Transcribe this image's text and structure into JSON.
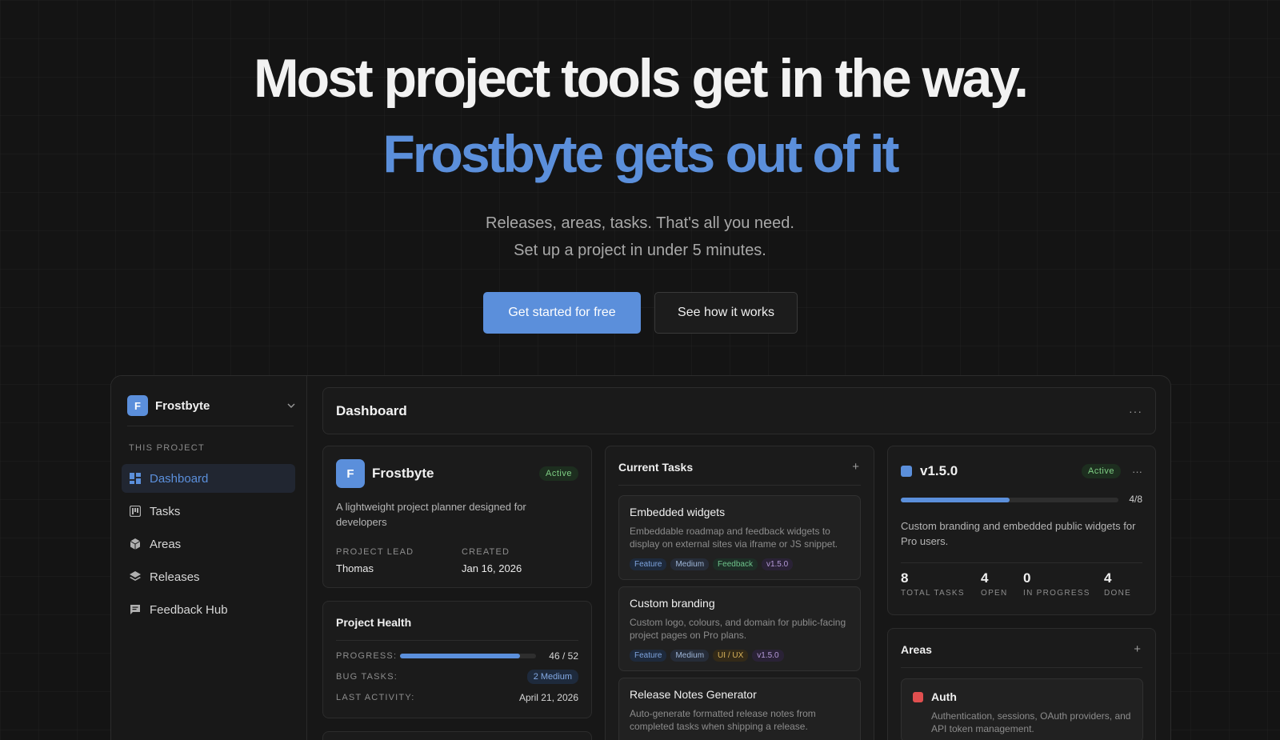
{
  "hero": {
    "headline": "Most project tools get in the way.",
    "headline_accent": "Frostbyte gets out of it",
    "subtitle_line1": "Releases, areas, tasks. That's all you need.",
    "subtitle_line2": "Set up a project in under 5 minutes.",
    "cta_primary": "Get started for free",
    "cta_secondary": "See how it works"
  },
  "colors": {
    "background": "#141414",
    "accent": "#5b8fdb",
    "active_badge": "#7fcf84",
    "area_auth": "#e04f4f"
  },
  "sidebar": {
    "project_initial": "F",
    "project_name": "Frostbyte",
    "section_label": "THIS PROJECT",
    "items": [
      {
        "label": "Dashboard",
        "icon": "dashboard-icon",
        "active": true
      },
      {
        "label": "Tasks",
        "icon": "tasks-icon",
        "active": false
      },
      {
        "label": "Areas",
        "icon": "cube-icon",
        "active": false
      },
      {
        "label": "Releases",
        "icon": "layers-icon",
        "active": false
      },
      {
        "label": "Feedback Hub",
        "icon": "chat-icon",
        "active": false
      }
    ]
  },
  "main": {
    "title": "Dashboard",
    "menu_icon": "more-icon"
  },
  "project_card": {
    "initial": "F",
    "name": "Frostbyte",
    "status": "Active",
    "description": "A lightweight project planner designed for developers",
    "lead_label": "PROJECT LEAD",
    "lead_value": "Thomas",
    "created_label": "CREATED",
    "created_value": "Jan 16, 2026"
  },
  "health": {
    "title": "Project Health",
    "progress_label": "PROGRESS:",
    "progress_value": "46 / 52",
    "progress_fraction": 0.885,
    "bugs_label": "BUG TASKS:",
    "bugs_value": "2 Medium",
    "activity_label": "LAST ACTIVITY:",
    "activity_value": "April 21, 2026"
  },
  "tasks": {
    "title": "Current Tasks",
    "add_icon": "plus-icon",
    "items": [
      {
        "title": "Embedded widgets",
        "description": "Embeddable roadmap and feedback widgets to display on external sites via iframe or JS snippet.",
        "tags": [
          "Feature",
          "Medium",
          "Feedback",
          "v1.5.0"
        ]
      },
      {
        "title": "Custom branding",
        "description": "Custom logo, colours, and domain for public-facing project pages on Pro plans.",
        "tags": [
          "Feature",
          "Medium",
          "UI / UX",
          "v1.5.0"
        ]
      },
      {
        "title": "Release Notes Generator",
        "description": "Auto-generate formatted release notes from completed tasks when shipping a release.",
        "tags": []
      }
    ]
  },
  "release": {
    "name": "v1.5.0",
    "status": "Active",
    "progress_text": "4/8",
    "progress_fraction": 0.5,
    "description": "Custom branding and embedded public widgets for Pro users.",
    "stats": [
      {
        "value": "8",
        "label": "TOTAL TASKS"
      },
      {
        "value": "4",
        "label": "OPEN"
      },
      {
        "value": "0",
        "label": "IN PROGRESS"
      },
      {
        "value": "4",
        "label": "DONE"
      }
    ]
  },
  "areas": {
    "title": "Areas",
    "add_icon": "plus-icon",
    "items": [
      {
        "name": "Auth",
        "description": "Authentication, sessions, OAuth providers, and API token management."
      }
    ]
  }
}
